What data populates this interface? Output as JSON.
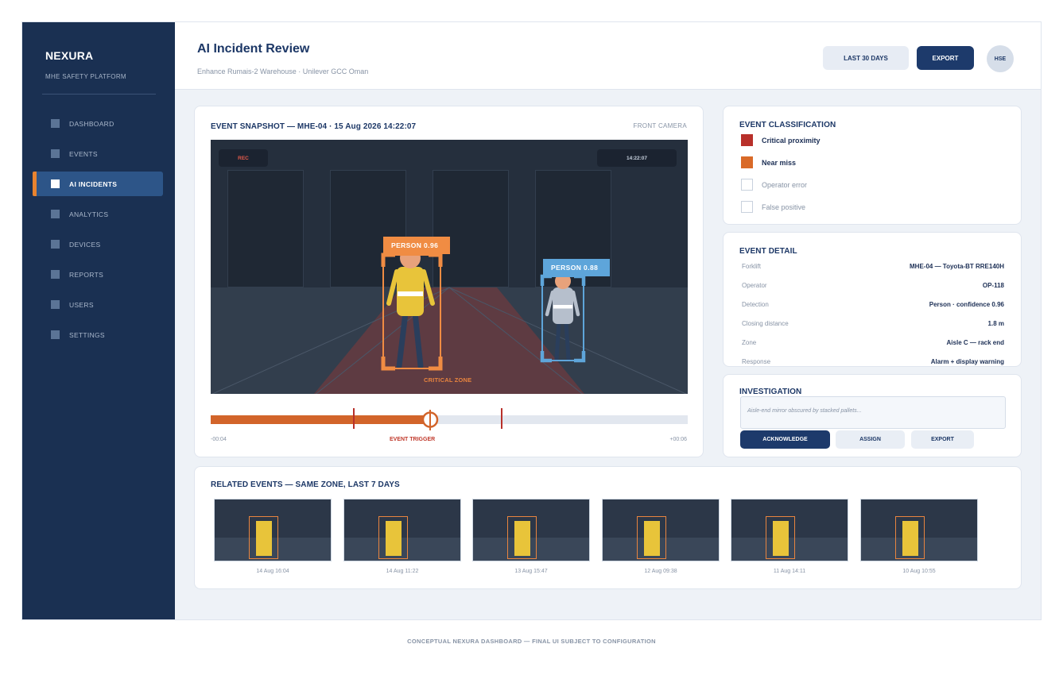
{
  "brand": {
    "name": "NEXURA",
    "subtitle": "MHE SAFETY PLATFORM"
  },
  "sidebar": {
    "items": [
      {
        "label": "DASHBOARD",
        "active": false
      },
      {
        "label": "EVENTS",
        "active": false
      },
      {
        "label": "AI INCIDENTS",
        "active": true
      },
      {
        "label": "ANALYTICS",
        "active": false
      },
      {
        "label": "DEVICES",
        "active": false
      },
      {
        "label": "REPORTS",
        "active": false
      },
      {
        "label": "USERS",
        "active": false
      },
      {
        "label": "SETTINGS",
        "active": false
      }
    ]
  },
  "header": {
    "title": "AI Incident Review",
    "subtitle": "Enhance Rumais-2 Warehouse · Unilever GCC Oman",
    "range_label": "LAST 30 DAYS",
    "export_label": "EXPORT",
    "avatar_initials": "HSE"
  },
  "snapshot": {
    "title": "EVENT SNAPSHOT — MHE-04 · 15 Aug 2026 14:22:07",
    "camera": "FRONT CAMERA",
    "rec_label": "REC",
    "time_overlay": "14:22:07",
    "zone_label": "CRITICAL ZONE",
    "detections": [
      {
        "label": "PERSON 0.96",
        "color": "#f08c43"
      },
      {
        "label": "PERSON 0.88",
        "color": "#5ea5da"
      }
    ],
    "timeline": {
      "start_label": "-00:04",
      "trigger_label": "EVENT TRIGGER",
      "end_label": "+00:06",
      "progress": 0.46
    }
  },
  "classification": {
    "title": "EVENT CLASSIFICATION",
    "items": [
      {
        "label": "Critical proximity",
        "checked": true,
        "color": "#b8302a"
      },
      {
        "label": "Near miss",
        "checked": true,
        "color": "#d96a28"
      },
      {
        "label": "Operator error",
        "checked": false
      },
      {
        "label": "False positive",
        "checked": false
      }
    ]
  },
  "detail": {
    "title": "EVENT DETAIL",
    "rows": [
      {
        "key": "Forklift",
        "value": "MHE-04 — Toyota-BT RRE140H"
      },
      {
        "key": "Operator",
        "value": "OP-118"
      },
      {
        "key": "Detection",
        "value": "Person · confidence 0.96"
      },
      {
        "key": "Closing distance",
        "value": "1.8 m"
      },
      {
        "key": "Zone",
        "value": "Aisle C — rack end"
      },
      {
        "key": "Response",
        "value": "Alarm + display warning"
      }
    ]
  },
  "investigation": {
    "title": "INVESTIGATION",
    "note_placeholder": "Aisle-end mirror obscured by stacked pallets...",
    "acknowledge_label": "ACKNOWLEDGE",
    "assign_label": "ASSIGN",
    "export_label": "EXPORT"
  },
  "related": {
    "title": "RELATED EVENTS — SAME ZONE, LAST 7 DAYS",
    "events": [
      {
        "time": "14 Aug 16:04"
      },
      {
        "time": "14 Aug 11:22"
      },
      {
        "time": "13 Aug 15:47"
      },
      {
        "time": "12 Aug 09:38"
      },
      {
        "time": "11 Aug 14:11"
      },
      {
        "time": "10 Aug 10:55"
      }
    ]
  },
  "footer": "CONCEPTUAL NEXURA DASHBOARD — FINAL UI SUBJECT TO CONFIGURATION"
}
